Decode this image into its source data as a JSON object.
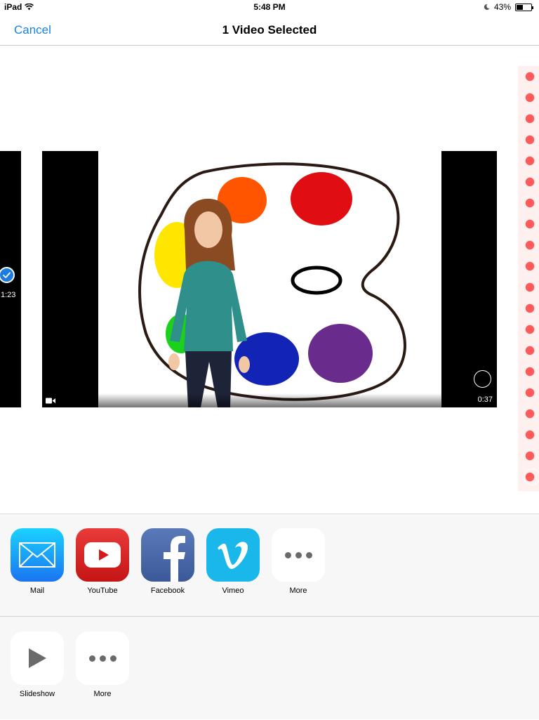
{
  "status_bar": {
    "device": "iPad",
    "time": "5:48 PM",
    "battery": "43%",
    "battery_level": 0.43
  },
  "nav": {
    "cancel_label": "Cancel",
    "title": "1 Video Selected"
  },
  "media": {
    "previous_video": {
      "duration": "1:23",
      "selected": true
    },
    "current_video": {
      "duration": "0:37",
      "selected": false
    },
    "next_item": {
      "selected": false
    }
  },
  "share_row": [
    {
      "label": "Mail",
      "icon": "mail-icon"
    },
    {
      "label": "YouTube",
      "icon": "youtube-icon"
    },
    {
      "label": "Facebook",
      "icon": "facebook-icon"
    },
    {
      "label": "Vimeo",
      "icon": "vimeo-icon"
    },
    {
      "label": "More",
      "icon": "more-icon"
    }
  ],
  "action_row": [
    {
      "label": "Slideshow",
      "icon": "play-icon"
    },
    {
      "label": "More",
      "icon": "more-icon"
    }
  ],
  "colors": {
    "accent": "#1a82e2",
    "check_blue": "#1e7ce0",
    "sheet_bg": "#f7f7f7"
  }
}
